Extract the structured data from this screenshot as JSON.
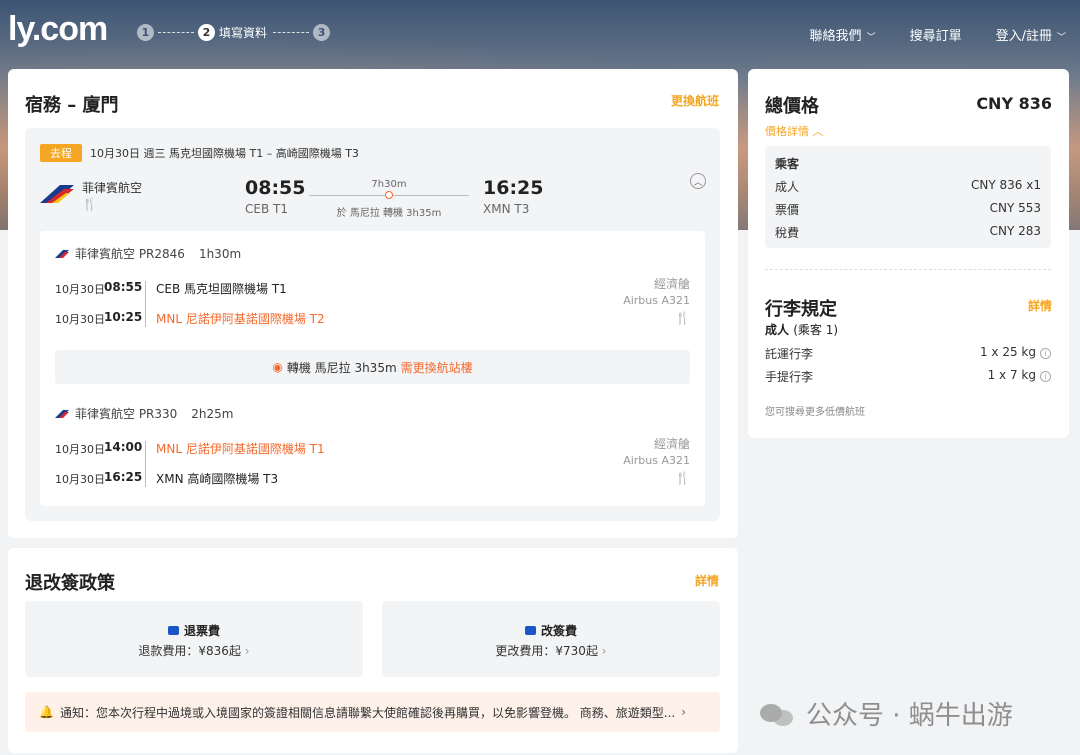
{
  "header": {
    "logo": "ly.com",
    "steps": [
      {
        "num": "1",
        "label": ""
      },
      {
        "num": "2",
        "label": "填寫資料"
      },
      {
        "num": "3",
        "label": ""
      }
    ],
    "nav": {
      "contact": "聯絡我們",
      "search_order": "搜尋訂單",
      "login": "登入/註冊"
    }
  },
  "flight": {
    "title": "宿務 – 廈門",
    "change_flight": "更換航班",
    "badge": "去程",
    "date": "10月30日 週三",
    "route": "馬克坦國際機場 T1 – 高崎國際機場 T3",
    "airline": "菲律賓航空",
    "dep_time": "08:55",
    "dep_code": "CEB T1",
    "arr_time": "16:25",
    "arr_code": "XMN T3",
    "duration": "7h30m",
    "transfer": "於 馬尼拉 轉機 3h35m",
    "segments": [
      {
        "head": "菲律賓航空 PR2846",
        "duration": "1h30m",
        "dep_date": "10月30日",
        "dep_time": "08:55",
        "dep_airport": "CEB 馬克坦國際機場 T1",
        "arr_date": "10月30日",
        "arr_time": "10:25",
        "arr_airport": "MNL 尼諾伊阿基諾國際機場 T2",
        "cabin": "經濟艙",
        "plane": "Airbus A321"
      },
      {
        "head": "菲律賓航空 PR330",
        "duration": "2h25m",
        "dep_date": "10月30日",
        "dep_time": "14:00",
        "dep_airport": "MNL 尼諾伊阿基諾國際機場 T1",
        "arr_date": "10月30日",
        "arr_time": "16:25",
        "arr_airport": "XMN 高崎國際機場 T3",
        "cabin": "經濟艙",
        "plane": "Airbus A321"
      }
    ],
    "layover": {
      "city": "轉機 馬尼拉 3h35m",
      "warning": "需更換航站樓"
    }
  },
  "policy": {
    "title": "退改簽政策",
    "details": "詳情",
    "refund": {
      "title": "退票費",
      "value": "退款費用：¥836起"
    },
    "change": {
      "title": "改簽費",
      "value": "更改費用：¥730起"
    },
    "notice": "通知：您本次行程中過境或入境國家的簽證相關信息請聯繫大使館確認後再購買，以免影響登機。 商務、旅遊類型..."
  },
  "price": {
    "total_label": "總價格",
    "total_value": "CNY 836",
    "detail_link": "價格詳情",
    "pax_head": "乘客",
    "rows": [
      {
        "label": "成人",
        "value": "CNY 836 x1"
      },
      {
        "label": "票價",
        "value": "CNY 553"
      },
      {
        "label": "稅費",
        "value": "CNY 283"
      }
    ],
    "baggage_title": "行李規定",
    "baggage_link": "詳情",
    "baggage_sub": "成人",
    "baggage_sub2": "(乘客 1)",
    "checked_label": "託運行李",
    "checked_value": "1 x 25 kg",
    "carry_label": "手提行李",
    "carry_value": "1 x 7 kg",
    "more": "您可搜尋更多低價航班"
  },
  "watermark": "公众号 · 蜗牛出游",
  "colors": {
    "accent": "#f5a623",
    "warning": "#f5692c",
    "blue": "#1a56c8"
  }
}
